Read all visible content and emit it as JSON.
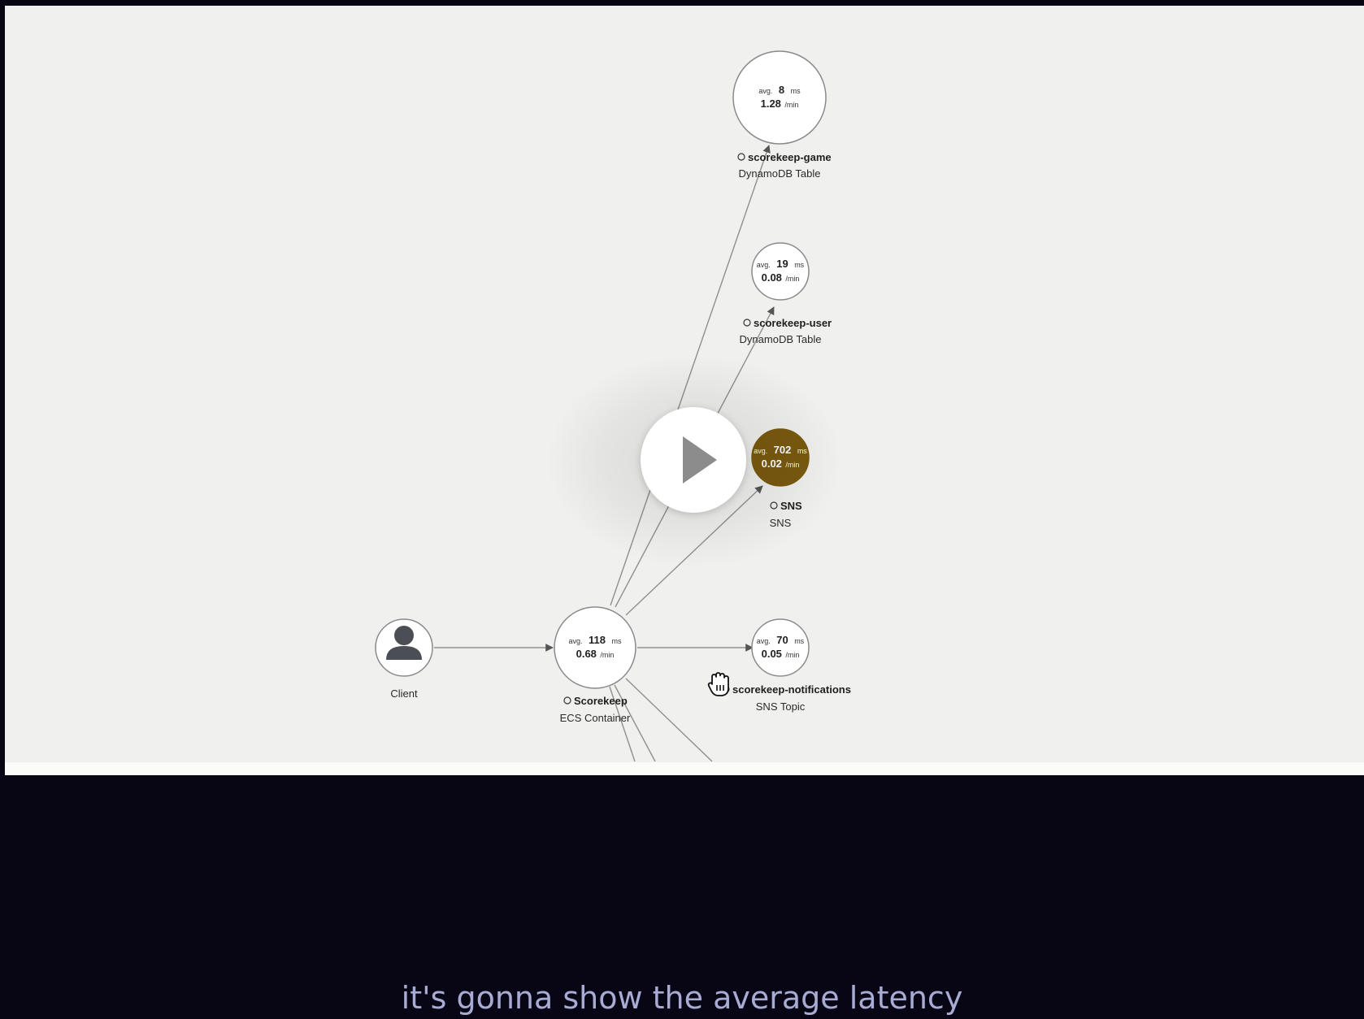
{
  "service_map": {
    "nodes": [
      {
        "id": "scorekeep-game",
        "avg": "8",
        "avg_prefix": "avg.",
        "avg_unit": "ms",
        "rate": "1.28",
        "rate_unit": "/min",
        "name": "scorekeep-game",
        "type": "DynamoDB Table",
        "status": "normal"
      },
      {
        "id": "scorekeep-user",
        "avg": "19",
        "avg_prefix": "avg.",
        "avg_unit": "ms",
        "rate": "0.08",
        "rate_unit": "/min",
        "name": "scorekeep-user",
        "type": "DynamoDB Table",
        "status": "normal"
      },
      {
        "id": "sns",
        "avg": "702",
        "avg_prefix": "avg.",
        "avg_unit": "ms",
        "rate": "0.02",
        "rate_unit": "/min",
        "name": "SNS",
        "type": "SNS",
        "status": "warning",
        "status_color": "#7a5a0f"
      },
      {
        "id": "scorekeep",
        "avg": "118",
        "avg_prefix": "avg.",
        "avg_unit": "ms",
        "rate": "0.68",
        "rate_unit": "/min",
        "name": "Scorekeep",
        "type": "ECS Container",
        "status": "normal"
      },
      {
        "id": "scorekeep-notifications",
        "avg": "70",
        "avg_prefix": "avg.",
        "avg_unit": "ms",
        "rate": "0.05",
        "rate_unit": "/min",
        "name": "scorekeep-notifications",
        "type": "SNS Topic",
        "status": "normal"
      }
    ],
    "client": {
      "label": "Client",
      "icon": "user-icon"
    },
    "edges": [
      {
        "from": "client",
        "to": "scorekeep"
      },
      {
        "from": "scorekeep",
        "to": "scorekeep-game"
      },
      {
        "from": "scorekeep",
        "to": "scorekeep-user"
      },
      {
        "from": "scorekeep",
        "to": "sns"
      },
      {
        "from": "scorekeep",
        "to": "scorekeep-notifications"
      }
    ]
  },
  "player": {
    "play_icon": "play-icon",
    "cursor_icon": "grab-hand-icon",
    "caption": "it's gonna show the average latency"
  },
  "colors": {
    "canvas_background": "#f0f1ef",
    "page_background": "#080614",
    "warning_node": "#7a5a0f",
    "caption_text": "#a8abd3"
  }
}
